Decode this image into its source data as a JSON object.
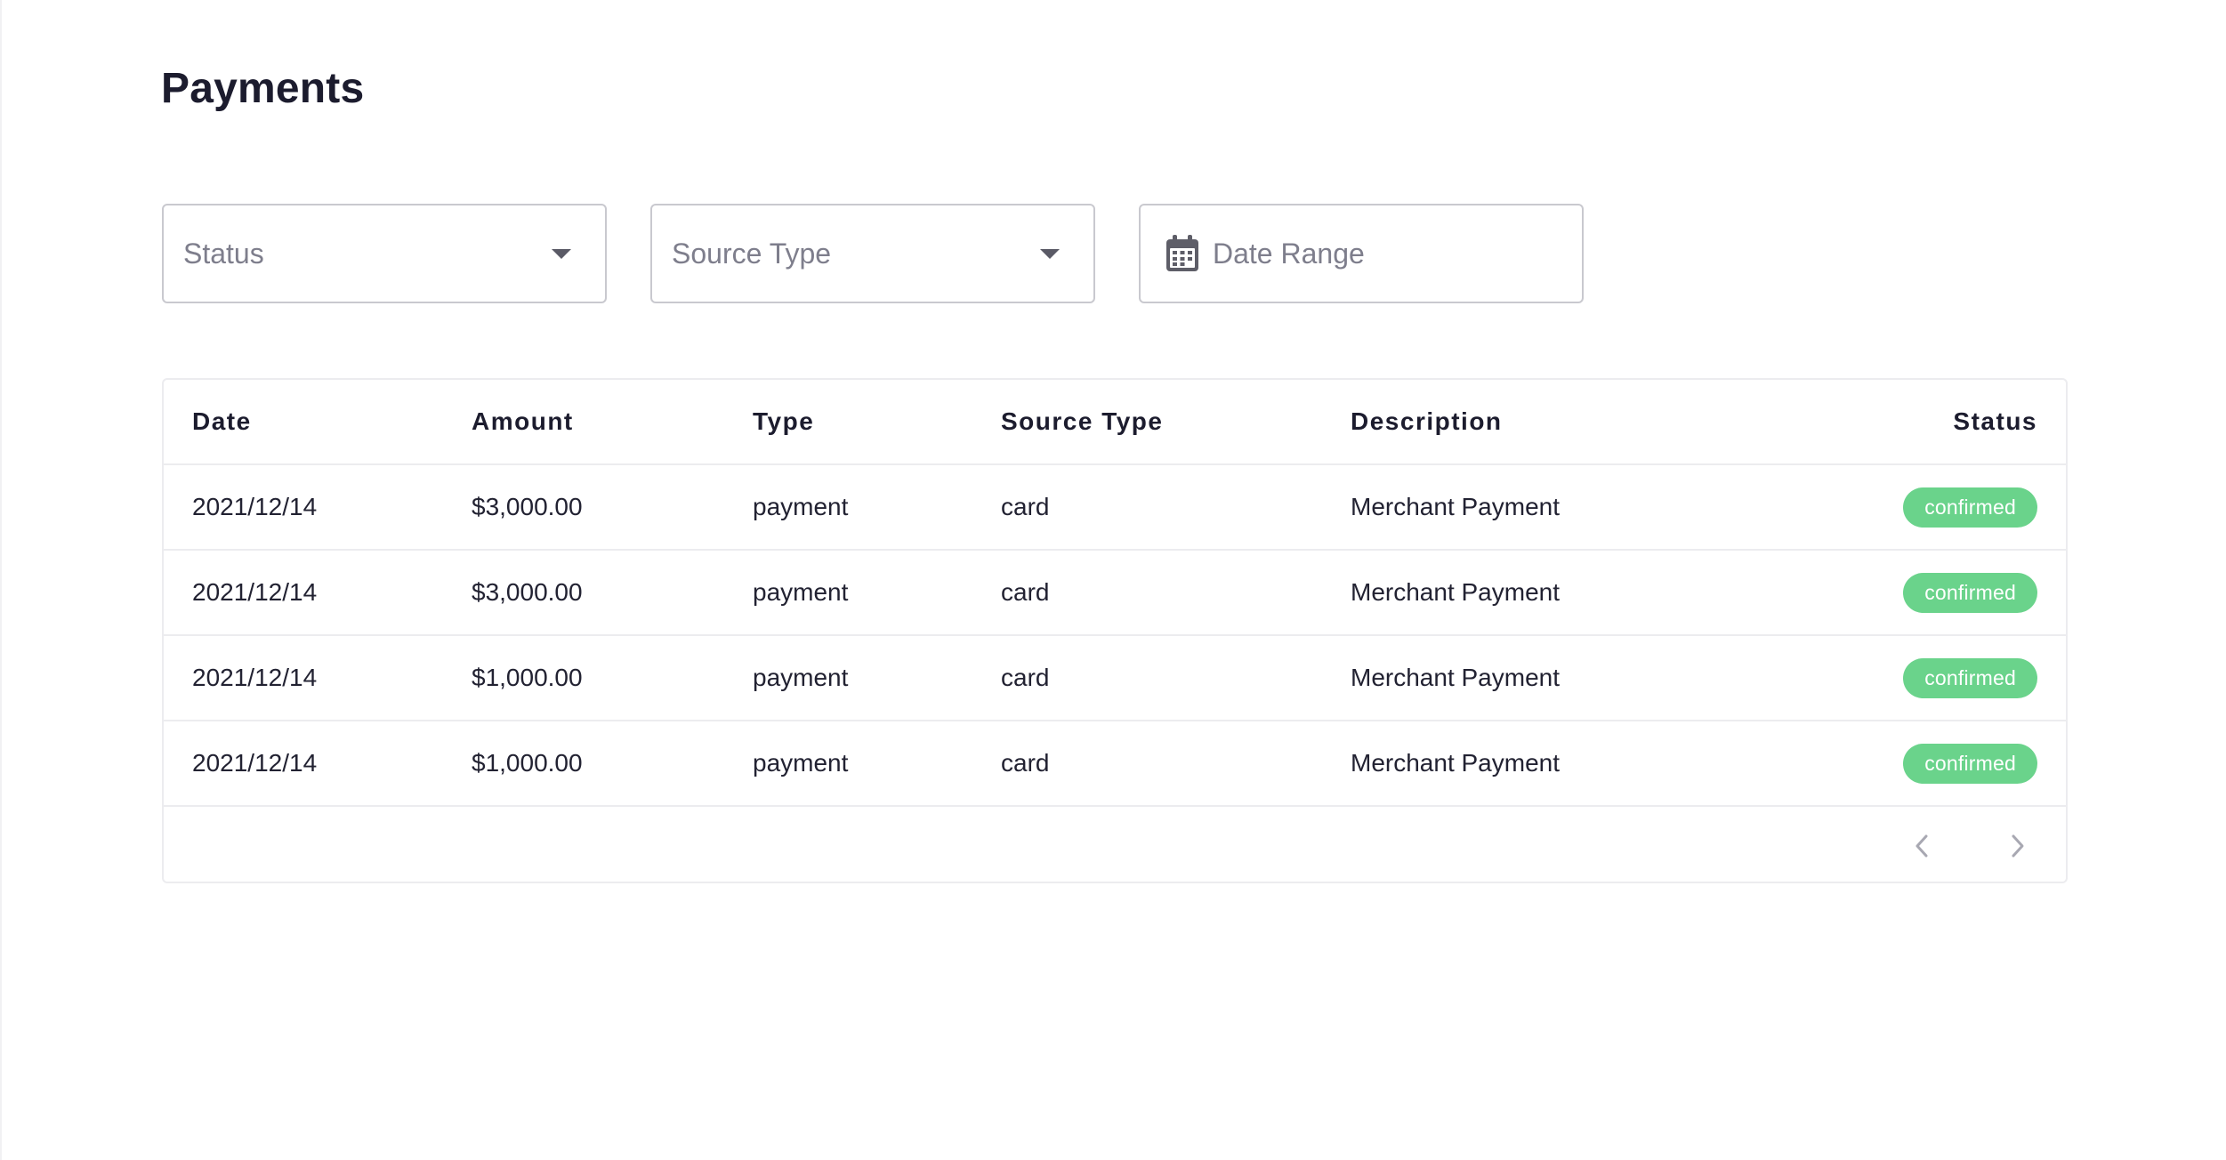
{
  "page": {
    "title": "Payments"
  },
  "filters": {
    "status": {
      "placeholder": "Status",
      "icon": "chevron-down-icon"
    },
    "source_type": {
      "placeholder": "Source Type",
      "icon": "chevron-down-icon"
    },
    "date_range": {
      "placeholder": "Date Range",
      "icon": "calendar-icon"
    }
  },
  "table": {
    "columns": {
      "date": "Date",
      "amount": "Amount",
      "type": "Type",
      "source_type": "Source Type",
      "description": "Description",
      "status": "Status"
    },
    "rows": [
      {
        "date": "2021/12/14",
        "amount": "$3,000.00",
        "type": "payment",
        "source_type": "card",
        "description": "Merchant Payment",
        "status": "confirmed"
      },
      {
        "date": "2021/12/14",
        "amount": "$3,000.00",
        "type": "payment",
        "source_type": "card",
        "description": "Merchant Payment",
        "status": "confirmed"
      },
      {
        "date": "2021/12/14",
        "amount": "$1,000.00",
        "type": "payment",
        "source_type": "card",
        "description": "Merchant Payment",
        "status": "confirmed"
      },
      {
        "date": "2021/12/14",
        "amount": "$1,000.00",
        "type": "payment",
        "source_type": "card",
        "description": "Merchant Payment",
        "status": "confirmed"
      }
    ]
  },
  "pagination": {
    "prev_icon": "chevron-left-icon",
    "next_icon": "chevron-right-icon"
  },
  "colors": {
    "status_confirmed": "#6ad38b",
    "text_primary": "#1c1c2e",
    "border": "#c9c9cf"
  }
}
